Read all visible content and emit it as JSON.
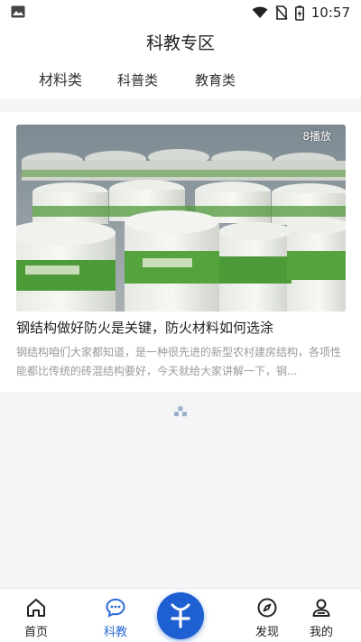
{
  "status_bar": {
    "time": "10:57"
  },
  "header": {
    "title": "科教专区"
  },
  "tabs": [
    {
      "label": "材料类"
    },
    {
      "label": "科普类"
    },
    {
      "label": "教育类"
    }
  ],
  "video_card": {
    "play_count": "8播放",
    "title": "钢结构做好防火是关键，防火材料如何选涂",
    "description": "钢结构咱们大家都知道，是一种很先进的新型农村建房结构，各项性能都比传统的砖混结构要好，今天就给大家讲解一下，钢..."
  },
  "tabbar": {
    "items": [
      {
        "label": "首页",
        "icon": "home-icon"
      },
      {
        "label": "科教",
        "icon": "chat-bubble-icon"
      },
      {
        "label": "",
        "icon": "plus-icon"
      },
      {
        "label": "发现",
        "icon": "compass-icon"
      },
      {
        "label": "我的",
        "icon": "user-icon"
      }
    ]
  },
  "colors": {
    "accent": "#2a6bd8",
    "fab": "#1e5fd1",
    "background": "#f5f5f7"
  }
}
